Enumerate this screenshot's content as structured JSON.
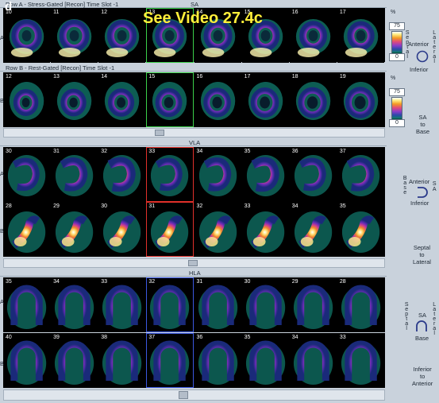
{
  "figure_label": "d",
  "video_overlay": "See Video 27.4c",
  "sa": {
    "title": "SA",
    "row_a_header": "Row A - Stress-Gated [Recon] Time Slot -1",
    "row_b_header": "Row B - Rest-Gated [Recon] Time Slot -1",
    "row_a_label": "A",
    "row_b_label": "B",
    "row_a_numbers": [
      "10",
      "11",
      "12",
      "13",
      "14",
      "15",
      "16",
      "17"
    ],
    "row_b_numbers": [
      "12",
      "13",
      "14",
      "15",
      "16",
      "17",
      "18",
      "19"
    ]
  },
  "vla": {
    "title": "VLA",
    "row_a_label": "A",
    "row_b_label": "B",
    "row_a_numbers": [
      "30",
      "31",
      "32",
      "33",
      "34",
      "35",
      "36",
      "37"
    ],
    "row_b_numbers": [
      "28",
      "29",
      "30",
      "31",
      "32",
      "33",
      "34",
      "35"
    ]
  },
  "hla": {
    "title": "HLA",
    "row_a_label": "A",
    "row_b_label": "B",
    "row_a_numbers": [
      "35",
      "34",
      "33",
      "32",
      "31",
      "30",
      "29",
      "28"
    ],
    "row_b_numbers": [
      "40",
      "39",
      "38",
      "37",
      "36",
      "35",
      "34",
      "33"
    ]
  },
  "colorscale": {
    "unit": "%",
    "max_a": "75",
    "min_a": "0",
    "max_b": "75",
    "min_b": "0",
    "gradient_colors": [
      "#ffffff",
      "#ffec80",
      "#f39a23",
      "#e04a7a",
      "#8a3cc8",
      "#2a4aa8",
      "#0f7a6a",
      "#000000"
    ]
  },
  "orientation": {
    "sa_left_vertical": "Septal",
    "sa_right_vertical": "Lateral",
    "sa_anterior": "Anterior",
    "sa_inferior": "Inferior",
    "sa_to_base": "SA\nto\nBase",
    "vla_left_vertical": "Base",
    "vla_right_vertical": "SA",
    "vla_anterior": "Anterior",
    "vla_inferior": "Inferior",
    "vla_septal_to_lateral": "Septal\nto\nLateral",
    "hla_left_vertical": "Septal",
    "hla_right_vertical": "Lateral",
    "hla_sa": "SA",
    "hla_base": "Base",
    "hla_inferior_to_anterior": "Inferior\nto\nAnterior"
  },
  "icons": {
    "sa_orientation": "circle-ring-icon",
    "vla_orientation": "u-shape-right-icon",
    "hla_orientation": "arch-shape-icon"
  }
}
